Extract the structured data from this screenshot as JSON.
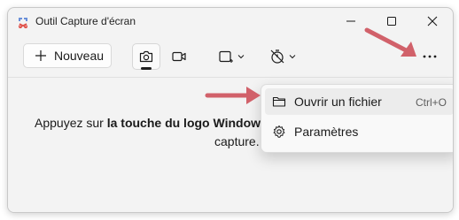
{
  "window": {
    "title": "Outil Capture d'écran"
  },
  "toolbar": {
    "new_label": "Nouveau",
    "tools": [
      {
        "name": "camera-icon",
        "active": true
      },
      {
        "name": "video-icon",
        "active": false
      },
      {
        "name": "snip-mode-icon",
        "active": false
      },
      {
        "name": "delay-timer-icon",
        "active": false
      }
    ],
    "more_icon": "more-options-icon"
  },
  "content": {
    "instruction_prefix": "Appuyez sur ",
    "instruction_bold": "la touche du logo Window",
    "instruction_line2": "capture."
  },
  "menu": {
    "items": [
      {
        "label": "Ouvrir un fichier",
        "shortcut": "Ctrl+O",
        "icon": "folder-icon"
      },
      {
        "label": "Paramètres",
        "shortcut": "",
        "icon": "gear-icon"
      }
    ]
  },
  "colors": {
    "annotation_arrow": "#d1616a",
    "window_bg": "#f3f3f3",
    "menu_bg": "#f9f9f9"
  }
}
